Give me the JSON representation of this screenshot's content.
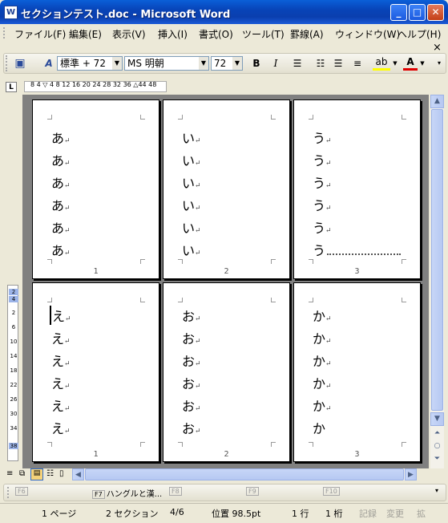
{
  "window": {
    "title": "セクションテスト.doc - Microsoft Word",
    "icon": "W"
  },
  "menu": [
    "ファイル(F)",
    "編集(E)",
    "表示(V)",
    "挿入(I)",
    "書式(O)",
    "ツール(T)",
    "罫線(A)",
    "ウィンドウ(W)",
    "ヘルプ(H)"
  ],
  "menu_close": "×",
  "toolbar": {
    "style": "標準 + 72",
    "font": "MS 明朝",
    "size": "72",
    "bold": "B",
    "italic": "I",
    "highlight_label": "ab",
    "fontcolor_label": "A"
  },
  "ruler": {
    "corner": "L",
    "ticks": "8 4 ▽ 4 8 12 16 20 24 28 32 36 △44 48"
  },
  "pages": [
    {
      "lines": [
        "あ",
        "あ",
        "あ",
        "あ",
        "あ",
        "あ"
      ],
      "number": "1"
    },
    {
      "lines": [
        "い",
        "い",
        "い",
        "い",
        "い",
        "い"
      ],
      "number": "2"
    },
    {
      "lines": [
        "う",
        "う",
        "う",
        "う",
        "う",
        "う"
      ],
      "number": "3"
    },
    {
      "lines": [
        "え",
        "え",
        "え",
        "え",
        "え",
        "え"
      ],
      "number": "1"
    },
    {
      "lines": [
        "お",
        "お",
        "お",
        "お",
        "お",
        "お"
      ],
      "number": "2"
    },
    {
      "lines": [
        "か",
        "か",
        "か",
        "か",
        "か",
        "か"
      ],
      "number": "3"
    }
  ],
  "vruler": [
    "2",
    "4",
    "2",
    "6",
    "10",
    "14",
    "18",
    "22",
    "26",
    "30",
    "34",
    "38"
  ],
  "fkeys": {
    "f6": "F6",
    "f7": "F7",
    "f7_label": "ハングルと漢...",
    "f8": "F8",
    "f9": "F9",
    "f10": "F10"
  },
  "status": {
    "page": "1 ページ",
    "section": "2 セクション",
    "pos_of": "4/6",
    "position": "位置 98.5pt",
    "line": "1 行",
    "col": "1 桁",
    "rec": "記録",
    "trk": "変更",
    "ext": "拡"
  }
}
